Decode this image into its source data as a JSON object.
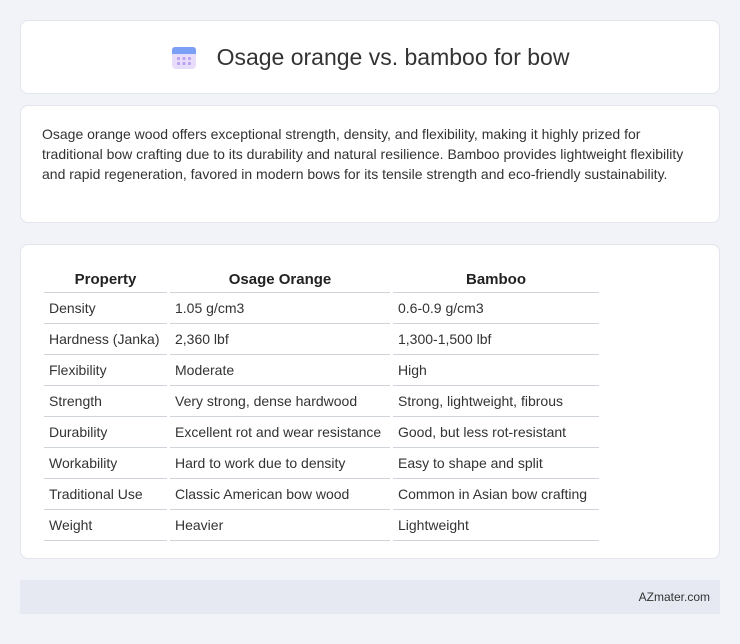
{
  "header": {
    "title": "Osage orange vs. bamboo for bow",
    "icon": "calendar-icon",
    "icon_colors": {
      "top": "#7b9ff5",
      "body": "#e7ddfa",
      "dots": "#b9a3ee"
    }
  },
  "description": "Osage orange wood offers exceptional strength, density, and flexibility, making it highly prized for traditional bow crafting due to its durability and natural resilience. Bamboo provides lightweight flexibility and rapid regeneration, favored in modern bows for its tensile strength and eco-friendly sustainability.",
  "table": {
    "headers": [
      "Property",
      "Osage Orange",
      "Bamboo"
    ],
    "rows": [
      [
        "Density",
        "1.05 g/cm3",
        "0.6-0.9 g/cm3"
      ],
      [
        "Hardness (Janka)",
        "2,360 lbf",
        "1,300-1,500 lbf"
      ],
      [
        "Flexibility",
        "Moderate",
        "High"
      ],
      [
        "Strength",
        "Very strong, dense hardwood",
        "Strong, lightweight, fibrous"
      ],
      [
        "Durability",
        "Excellent rot and wear resistance",
        "Good, but less rot-resistant"
      ],
      [
        "Workability",
        "Hard to work due to density",
        "Easy to shape and split"
      ],
      [
        "Traditional Use",
        "Classic American bow wood",
        "Common in Asian bow crafting"
      ],
      [
        "Weight",
        "Heavier",
        "Lightweight"
      ]
    ]
  },
  "footer": {
    "brand": "AZmater.com"
  }
}
